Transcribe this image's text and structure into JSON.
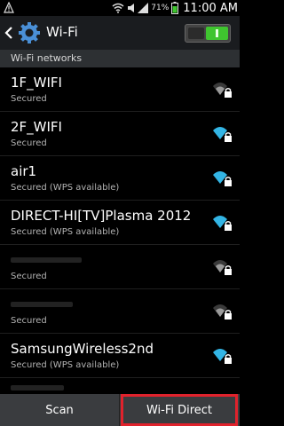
{
  "status_bar": {
    "battery_percent": "71%",
    "time": "11:00 AM"
  },
  "action_bar": {
    "title": "Wi-Fi",
    "toggle_state": "on"
  },
  "section_header": "Wi-Fi networks",
  "networks": [
    {
      "name": "1F_WIFI",
      "status": "Secured",
      "signal": "medium"
    },
    {
      "name": "2F_WIFI",
      "status": "Secured",
      "signal": "strong"
    },
    {
      "name": "air1",
      "status": "Secured (WPS available)",
      "signal": "strong"
    },
    {
      "name": "DIRECT-HI[TV]Plasma 2012",
      "status": "Secured (WPS available)",
      "signal": "strong"
    },
    {
      "name": "",
      "status": "Secured",
      "signal": "medium"
    },
    {
      "name": "",
      "status": "Secured",
      "signal": "medium"
    },
    {
      "name": "SamsungWireless2nd",
      "status": "Secured (WPS available)",
      "signal": "strong"
    },
    {
      "name": "",
      "status": "",
      "signal": "medium"
    }
  ],
  "bottom_bar": {
    "scan_label": "Scan",
    "wifi_direct_label": "Wi-Fi Direct"
  },
  "colors": {
    "wifi_strong": "#33b5e5",
    "wifi_medium": "#9a9a9a",
    "toggle_on": "#3fc52f",
    "highlight": "#e0222c"
  }
}
